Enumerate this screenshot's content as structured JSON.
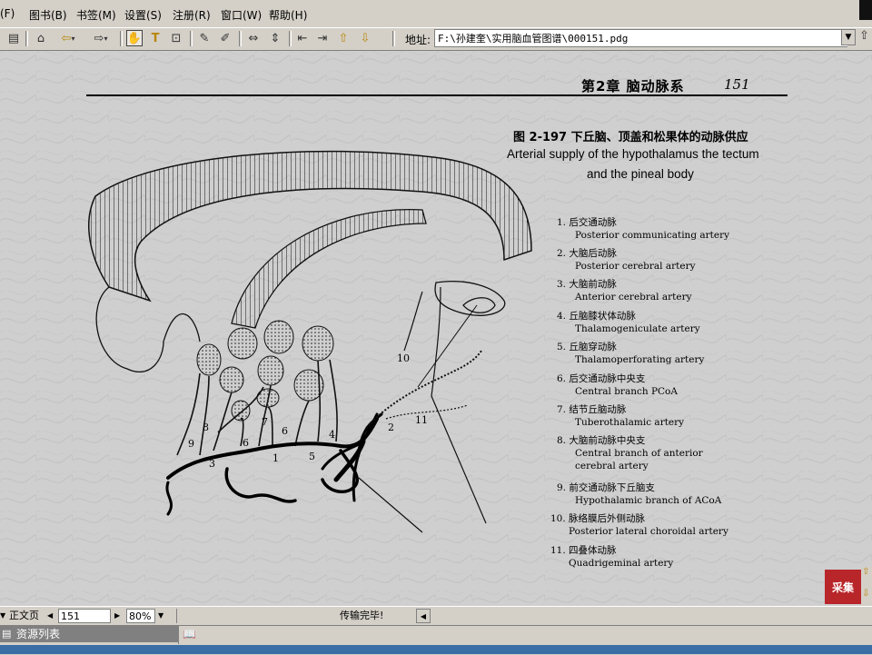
{
  "menu": {
    "items": [
      "(F)",
      "图书(B)",
      "书签(M)",
      "设置(S)",
      "注册(R)",
      "窗口(W)",
      "帮助(H)"
    ]
  },
  "toolbar": {
    "icons": [
      "panel-icon",
      "home-icon",
      "back-icon",
      "forward-icon",
      "hand-icon",
      "text-select-icon",
      "zoom-area-icon",
      "annotate-icon",
      "highlight-icon",
      "fit-width-icon",
      "fit-height-icon",
      "first-page-icon",
      "last-page-icon",
      "prev-page-icon",
      "next-page-icon"
    ],
    "address_label": "地址:",
    "address_value": "F:\\孙建奎\\实用脑血管图谱\\000151.pdg"
  },
  "document": {
    "chapter_header": "第2章  脑动脉系",
    "page_number": "151",
    "figure_title_cn": "图 2-197   下丘脑、顶盖和松果体的动脉供应",
    "figure_title_en_line1": "Arterial supply of the hypothalamus the tectum",
    "figure_title_en_line2": "and the pineal body",
    "figure_labels": [
      "1",
      "2",
      "3",
      "4",
      "5",
      "6",
      "6",
      "7",
      "8",
      "9",
      "10",
      "11"
    ],
    "legend": [
      {
        "cn": "1.  后交通动脉",
        "en": "Posterior communicating artery"
      },
      {
        "cn": "2.  大脑后动脉",
        "en": "Posterior cerebral artery"
      },
      {
        "cn": "3.  大脑前动脉",
        "en": "Anterior cerebral artery"
      },
      {
        "cn": "4.  丘脑膝状体动脉",
        "en": "Thalamogeniculate artery"
      },
      {
        "cn": "5.  丘脑穿动脉",
        "en": "Thalamoperforating artery"
      },
      {
        "cn": "6.  后交通动脉中央支",
        "en": "Central branch PCoA"
      },
      {
        "cn": "7.  结节丘脑动脉",
        "en": "Tuberothalamic artery"
      },
      {
        "cn": "8.  大脑前动脉中央支",
        "en": "Central branch of anterior",
        "en2": "cerebral artery"
      },
      {
        "cn": "9.  前交通动脉下丘脑支",
        "en": "Hypothalamic branch of ACoA"
      },
      {
        "cn": "10.  脉络膜后外侧动脉",
        "en": "Posterior lateral choroidal artery"
      },
      {
        "cn": "11.  四叠体动脉",
        "en": "Quadrigeminal artery"
      }
    ]
  },
  "status": {
    "page_type": "正文页",
    "page_number": "151",
    "zoom": "80%",
    "message": "传输完毕!"
  },
  "panel": {
    "resource_list": "资源列表",
    "logo_text": "采集"
  },
  "colors": {
    "chrome": "#d4d0c8",
    "page_bg": "#cfcfcf",
    "taskbar_blue": "#3a6ea5",
    "logo_red": "#b8262a"
  }
}
